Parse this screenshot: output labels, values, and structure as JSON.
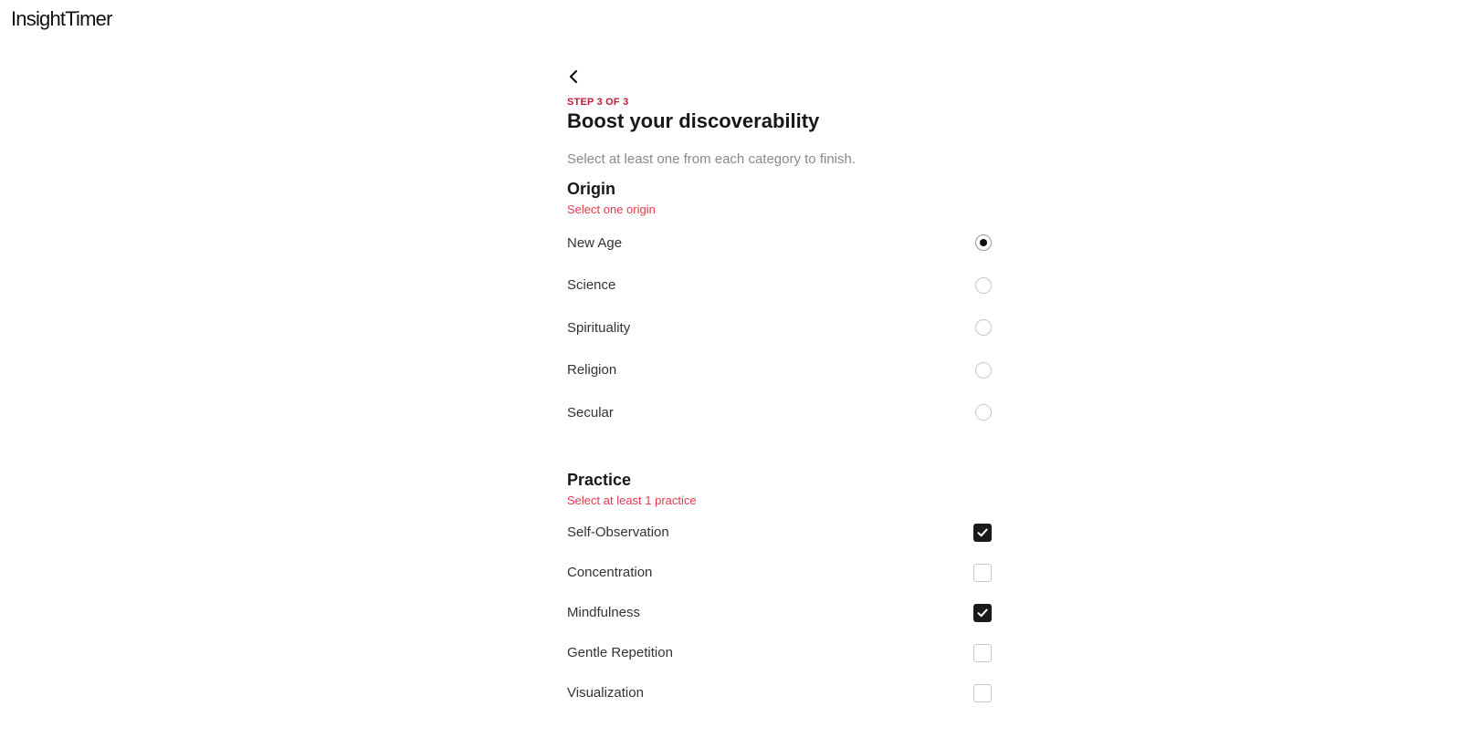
{
  "app": {
    "logo": "InsightTimer"
  },
  "header": {
    "step": "STEP 3 OF 3",
    "title": "Boost your discoverability",
    "subtitle": "Select at least one from each category to finish."
  },
  "origin": {
    "title": "Origin",
    "hint": "Select one origin",
    "selected": "New Age",
    "options": [
      {
        "label": "New Age",
        "checked": true
      },
      {
        "label": "Science",
        "checked": false
      },
      {
        "label": "Spirituality",
        "checked": false
      },
      {
        "label": "Religion",
        "checked": false
      },
      {
        "label": "Secular",
        "checked": false
      }
    ]
  },
  "practice": {
    "title": "Practice",
    "hint": "Select at least 1 practice",
    "options": [
      {
        "label": "Self-Observation",
        "checked": true
      },
      {
        "label": "Concentration",
        "checked": false
      },
      {
        "label": "Mindfulness",
        "checked": true
      },
      {
        "label": "Gentle Repetition",
        "checked": false
      },
      {
        "label": "Visualization",
        "checked": false
      }
    ]
  },
  "colors": {
    "accent_step": "#b81f3c",
    "hint": "#e23b4e",
    "check_fill": "#1a1a1a"
  }
}
